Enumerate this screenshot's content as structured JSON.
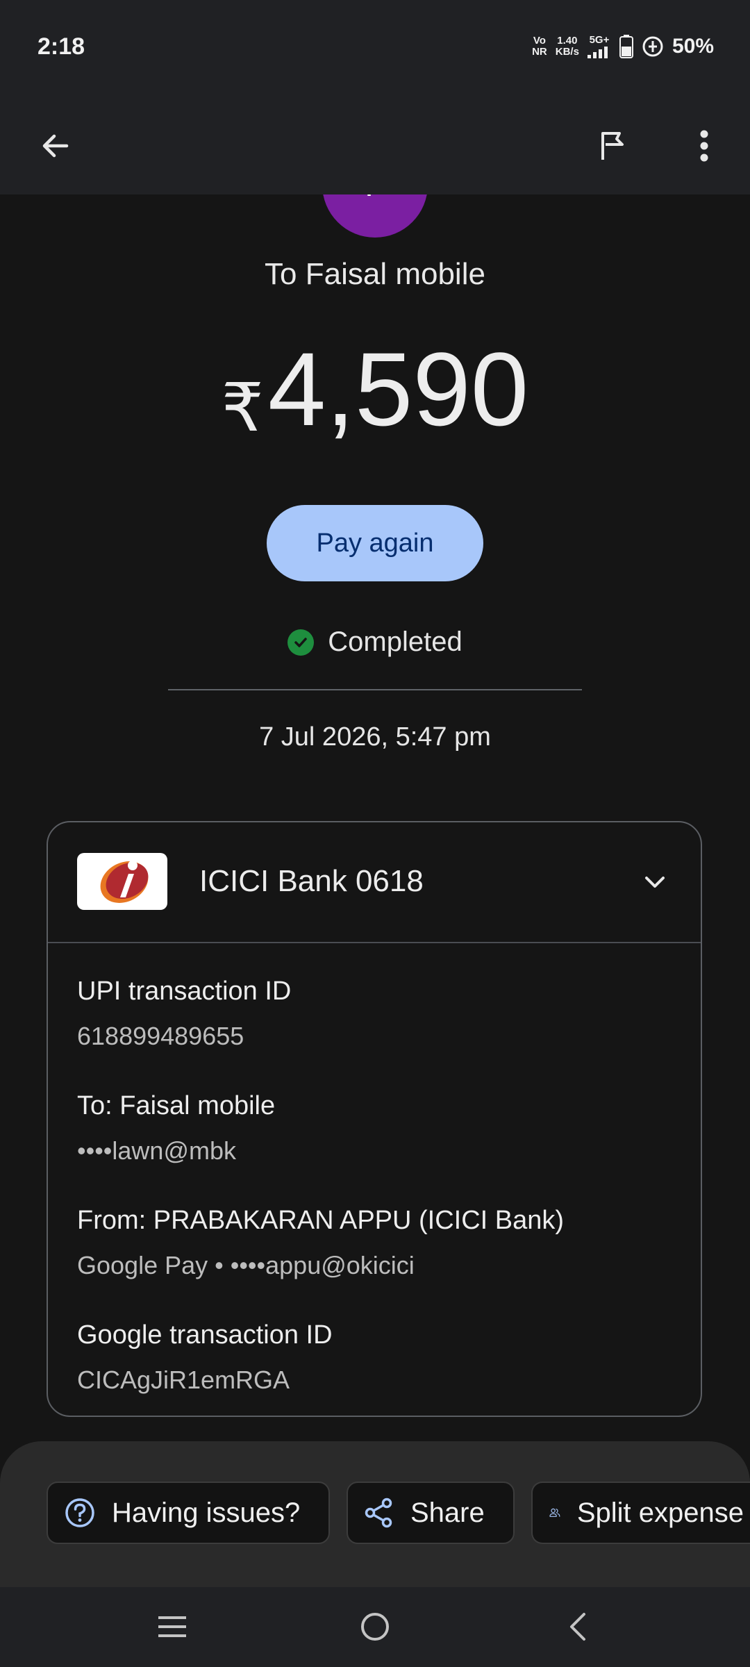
{
  "status_bar": {
    "time": "2:18",
    "volte_top": "Vo",
    "volte_bottom": "NR",
    "speed_top": "1.40",
    "speed_bottom": "KB/s",
    "network": "5G+",
    "battery": "50%"
  },
  "app_bar": {
    "back_icon": "arrow-back-icon",
    "flag_icon": "flag-icon",
    "menu_icon": "more-vert-icon"
  },
  "payment": {
    "avatar_initial": "F",
    "avatar_color": "#7b1fa2",
    "to_label": "To Faisal mobile",
    "currency_symbol": "₹",
    "amount": "4,590",
    "pay_again_label": "Pay again",
    "status": "Completed",
    "status_color": "#1e8e3e",
    "datetime": "7 Jul 2026, 5:47 pm"
  },
  "card": {
    "bank_name": "ICICI Bank 0618",
    "details": [
      {
        "label": "UPI transaction ID",
        "value": "618899489655"
      },
      {
        "label": "To: Faisal mobile",
        "value": "••••lawn@mbk"
      },
      {
        "label": "From: PRABAKARAN APPU (ICICI Bank)",
        "value": "Google Pay • ••••appu@okicici"
      },
      {
        "label": "Google transaction ID",
        "value": "CICAgJiR1emRGA"
      }
    ]
  },
  "actions": {
    "having_issues": "Having issues?",
    "share": "Share",
    "split": "Split expense"
  },
  "nav": {
    "recents_icon": "menu-icon",
    "home_icon": "home-circle-icon",
    "back_icon": "nav-back-icon"
  },
  "colors": {
    "accent": "#a8c7fa",
    "background": "#151515",
    "bar": "#202124"
  }
}
